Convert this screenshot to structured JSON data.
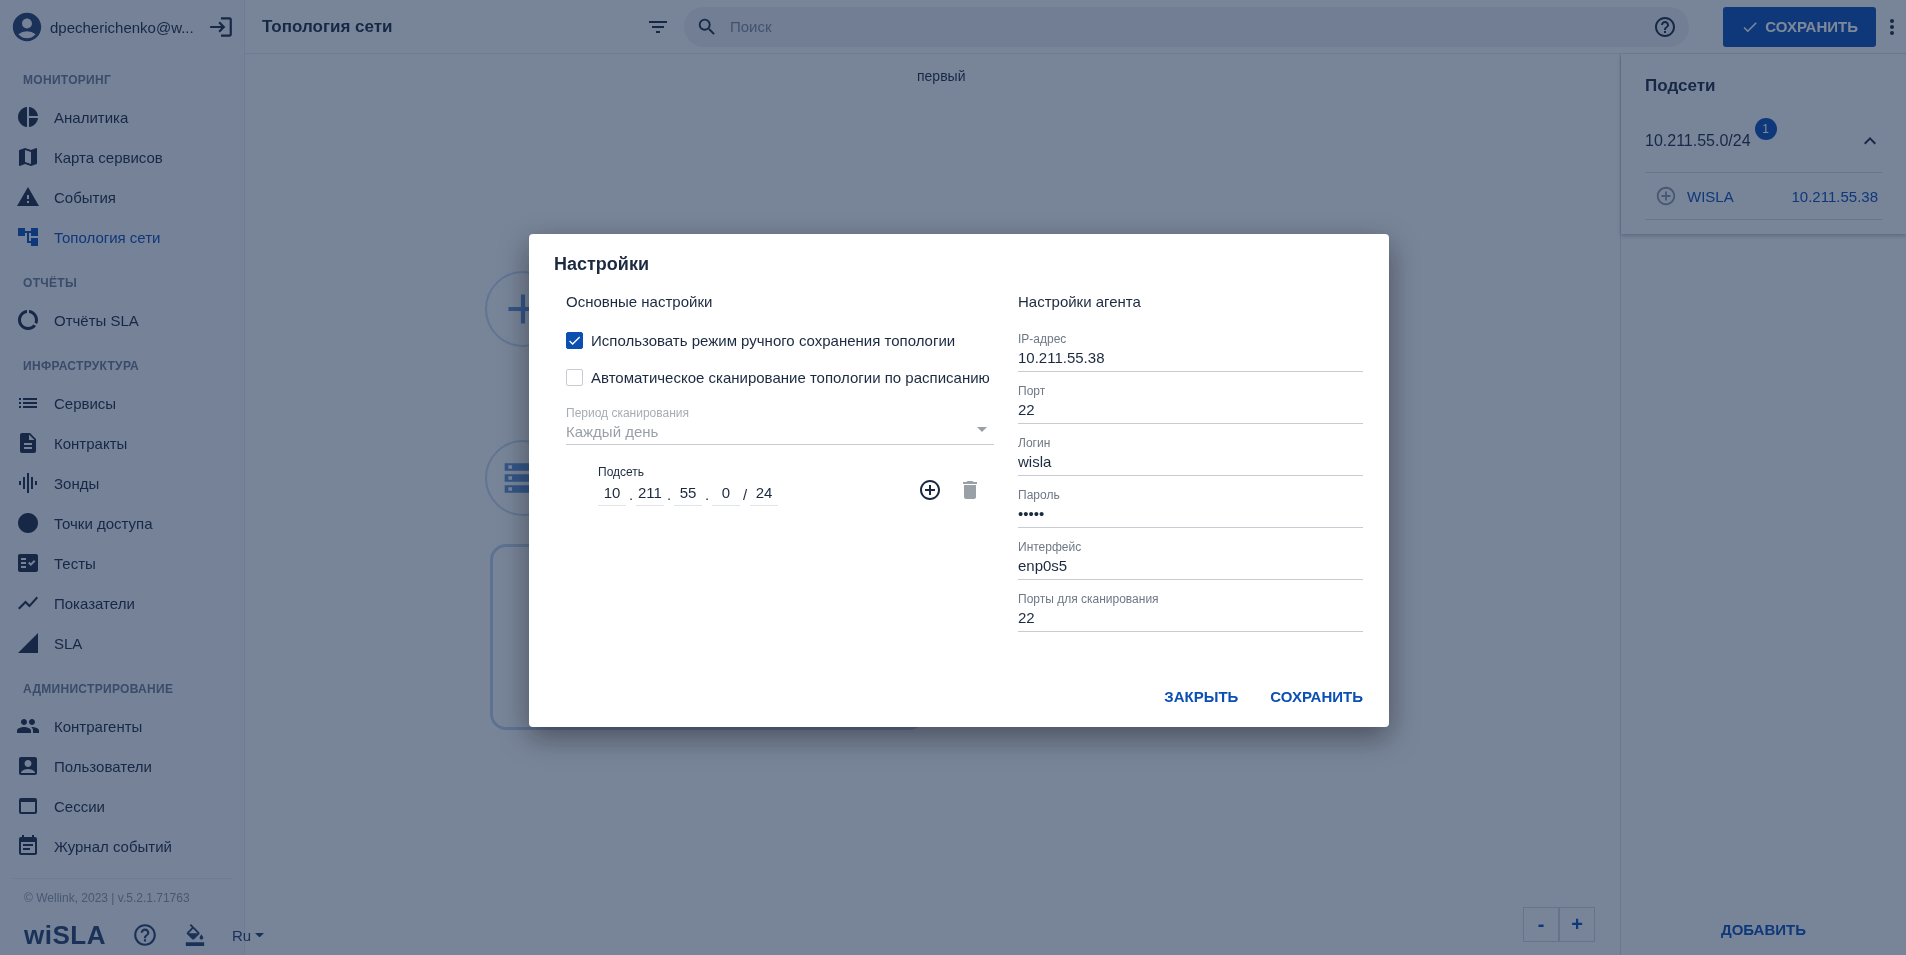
{
  "user": {
    "name": "dpecherichenko@w..."
  },
  "sidebar": {
    "sections": [
      {
        "title": "МОНИТОРИНГ",
        "items": [
          {
            "label": "Аналитика",
            "selected": false
          },
          {
            "label": "Карта сервисов",
            "selected": false
          },
          {
            "label": "События",
            "selected": false
          },
          {
            "label": "Топология сети",
            "selected": true
          }
        ]
      },
      {
        "title": "ОТЧЁТЫ",
        "items": [
          {
            "label": "Отчёты SLA",
            "selected": false
          }
        ]
      },
      {
        "title": "ИНФРАСТРУКТУРА",
        "items": [
          {
            "label": "Сервисы",
            "selected": false
          },
          {
            "label": "Контракты",
            "selected": false
          },
          {
            "label": "Зонды",
            "selected": false
          },
          {
            "label": "Точки доступа",
            "selected": false
          },
          {
            "label": "Тесты",
            "selected": false
          },
          {
            "label": "Показатели",
            "selected": false
          },
          {
            "label": "SLA",
            "selected": false
          }
        ]
      },
      {
        "title": "АДМИНИСТРИРОВАНИЕ",
        "items": [
          {
            "label": "Контрагенты",
            "selected": false
          },
          {
            "label": "Пользователи",
            "selected": false
          },
          {
            "label": "Сессии",
            "selected": false
          },
          {
            "label": "Журнал событий",
            "selected": false
          }
        ]
      }
    ]
  },
  "footer": {
    "copyright": "© Wellink, 2023 | v.5.2.1.71763",
    "logo": "wiSLA",
    "language": "Ru"
  },
  "topbar": {
    "title": "Топология сети",
    "search": {
      "placeholder": "Поиск"
    },
    "save_button": "СОХРАНИТЬ"
  },
  "canvas": {
    "node_label": "первый",
    "zoom_out": "-",
    "zoom_in": "+"
  },
  "right_panel": {
    "title": "Подсети",
    "subnets": [
      {
        "address": "10.211.55.0/24",
        "badge": "1",
        "expanded": true,
        "hosts": [
          {
            "name": "WISLA",
            "ip": "10.211.55.38"
          }
        ]
      }
    ],
    "add_button": "ДОБАВИТЬ"
  },
  "dialog": {
    "title": "Настройки",
    "left": {
      "heading": "Основные настройки",
      "checkboxes": [
        {
          "label": "Использовать режим ручного сохранения топологии",
          "checked": true
        },
        {
          "label": "Автоматическое сканирование топологии по расписанию",
          "checked": false
        }
      ],
      "period": {
        "label": "Период сканирования",
        "value": "Каждый день",
        "disabled": true
      },
      "subnet": {
        "label": "Подсеть",
        "parts": [
          {
            "value": "10",
            "sep": "."
          },
          {
            "value": "211",
            "sep": "."
          },
          {
            "value": "55",
            "sep": "."
          },
          {
            "value": "0",
            "sep": "/"
          },
          {
            "value": "24"
          }
        ]
      }
    },
    "right": {
      "heading": "Настройки агента",
      "fields": [
        {
          "label": "IP-адрес",
          "value": "10.211.55.38"
        },
        {
          "label": "Порт",
          "value": "22"
        },
        {
          "label": "Логин",
          "value": "wisla"
        },
        {
          "label": "Пароль",
          "value": "•••••"
        },
        {
          "label": "Интерфейс",
          "value": "enp0s5"
        },
        {
          "label": "Порты для сканирования",
          "value": "22"
        }
      ]
    },
    "buttons": [
      "ЗАКРЫТЬ",
      "СОХРАНИТЬ"
    ]
  }
}
